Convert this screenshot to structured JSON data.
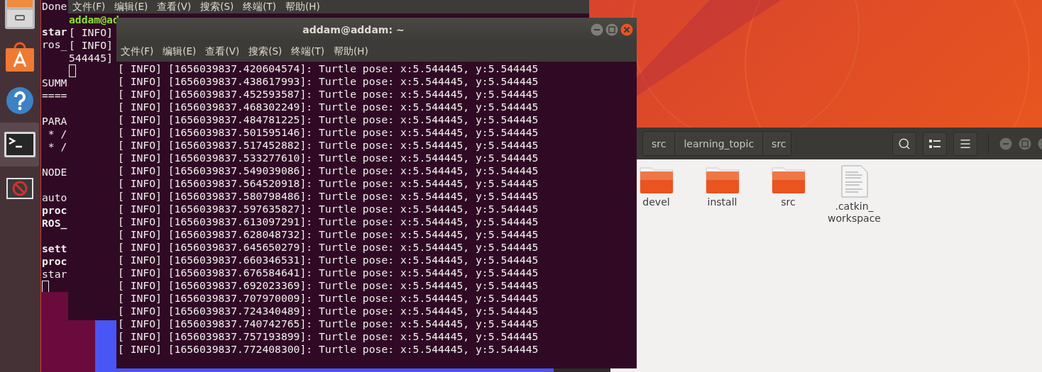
{
  "launcher": {
    "items": [
      {
        "kind": "files",
        "selected": false
      },
      {
        "kind": "store",
        "selected": false
      },
      {
        "kind": "help",
        "selected": false
      },
      {
        "kind": "terminal",
        "selected": true
      },
      {
        "kind": "blocked",
        "selected": false
      }
    ]
  },
  "back_terminal": {
    "cursor": true,
    "lines": [
      {
        "kind": "text",
        "text": "Done"
      },
      {
        "kind": "blank"
      },
      {
        "kind": "bold",
        "text": "star"
      },
      {
        "kind": "text",
        "text": "ros_"
      },
      {
        "kind": "blank"
      },
      {
        "kind": "blank"
      },
      {
        "kind": "text",
        "text": "SUMM"
      },
      {
        "kind": "text",
        "text": "===="
      },
      {
        "kind": "blank"
      },
      {
        "kind": "text",
        "text": "PARA"
      },
      {
        "kind": "text",
        "text": " * /"
      },
      {
        "kind": "text",
        "text": " * /"
      },
      {
        "kind": "blank"
      },
      {
        "kind": "text",
        "text": "NODE"
      },
      {
        "kind": "blank"
      },
      {
        "kind": "text",
        "text": "auto"
      },
      {
        "kind": "bold",
        "text": "proc"
      },
      {
        "kind": "bold",
        "text": "ROS_"
      },
      {
        "kind": "blank"
      },
      {
        "kind": "bold",
        "text": "sett"
      },
      {
        "kind": "bold",
        "text": "proc"
      },
      {
        "kind": "text",
        "text": "star"
      }
    ]
  },
  "middle_terminal": {
    "cursor": true,
    "menu": [
      "文件(F)",
      "编辑(E)",
      "查看(V)",
      "搜索(S)",
      "终端(T)",
      "帮助(H)"
    ],
    "lines": [
      {
        "kind": "prompt",
        "text": "addam@ad"
      },
      {
        "kind": "text",
        "text": "[ INFO]"
      },
      {
        "kind": "text",
        "text": "[ INFO]"
      },
      {
        "kind": "text",
        "text": "544445]"
      }
    ]
  },
  "front_terminal": {
    "title": "addam@addam: ~",
    "menu": [
      "文件(F)",
      "编辑(E)",
      "查看(V)",
      "搜索(S)",
      "终端(T)",
      "帮助(H)"
    ],
    "lines": [
      {
        "kind": "text",
        "text": "[ INFO] [1656039837.420604574]: Turtle pose: x:5.544445, y:5.544445"
      },
      {
        "kind": "text",
        "text": "[ INFO] [1656039837.438617993]: Turtle pose: x:5.544445, y:5.544445"
      },
      {
        "kind": "text",
        "text": "[ INFO] [1656039837.452593587]: Turtle pose: x:5.544445, y:5.544445"
      },
      {
        "kind": "text",
        "text": "[ INFO] [1656039837.468302249]: Turtle pose: x:5.544445, y:5.544445"
      },
      {
        "kind": "text",
        "text": "[ INFO] [1656039837.484781225]: Turtle pose: x:5.544445, y:5.544445"
      },
      {
        "kind": "text",
        "text": "[ INFO] [1656039837.501595146]: Turtle pose: x:5.544445, y:5.544445"
      },
      {
        "kind": "text",
        "text": "[ INFO] [1656039837.517452882]: Turtle pose: x:5.544445, y:5.544445"
      },
      {
        "kind": "text",
        "text": "[ INFO] [1656039837.533277610]: Turtle pose: x:5.544445, y:5.544445"
      },
      {
        "kind": "text",
        "text": "[ INFO] [1656039837.549039086]: Turtle pose: x:5.544445, y:5.544445"
      },
      {
        "kind": "text",
        "text": "[ INFO] [1656039837.564520918]: Turtle pose: x:5.544445, y:5.544445"
      },
      {
        "kind": "text",
        "text": "[ INFO] [1656039837.580798486]: Turtle pose: x:5.544445, y:5.544445"
      },
      {
        "kind": "text",
        "text": "[ INFO] [1656039837.597635827]: Turtle pose: x:5.544445, y:5.544445"
      },
      {
        "kind": "text",
        "text": "[ INFO] [1656039837.613097291]: Turtle pose: x:5.544445, y:5.544445"
      },
      {
        "kind": "text",
        "text": "[ INFO] [1656039837.628048732]: Turtle pose: x:5.544445, y:5.544445"
      },
      {
        "kind": "text",
        "text": "[ INFO] [1656039837.645650279]: Turtle pose: x:5.544445, y:5.544445"
      },
      {
        "kind": "text",
        "text": "[ INFO] [1656039837.660346531]: Turtle pose: x:5.544445, y:5.544445"
      },
      {
        "kind": "text",
        "text": "[ INFO] [1656039837.676584641]: Turtle pose: x:5.544445, y:5.544445"
      },
      {
        "kind": "text",
        "text": "[ INFO] [1656039837.692023369]: Turtle pose: x:5.544445, y:5.544445"
      },
      {
        "kind": "text",
        "text": "[ INFO] [1656039837.707970009]: Turtle pose: x:5.544445, y:5.544445"
      },
      {
        "kind": "text",
        "text": "[ INFO] [1656039837.724340489]: Turtle pose: x:5.544445, y:5.544445"
      },
      {
        "kind": "text",
        "text": "[ INFO] [1656039837.740742765]: Turtle pose: x:5.544445, y:5.544445"
      },
      {
        "kind": "text",
        "text": "[ INFO] [1656039837.757193899]: Turtle pose: x:5.544445, y:5.544445"
      },
      {
        "kind": "text",
        "text": "[ INFO] [1656039837.772408300]: Turtle pose: x:5.544445, y:5.544445"
      }
    ]
  },
  "file_manager": {
    "path": [
      {
        "label": "src"
      },
      {
        "label": "learning_topic"
      },
      {
        "label": "src"
      }
    ],
    "items": [
      {
        "kind": "folder",
        "lines": [
          "devel"
        ]
      },
      {
        "kind": "folder",
        "lines": [
          "install"
        ]
      },
      {
        "kind": "folder",
        "lines": [
          "src"
        ]
      },
      {
        "kind": "file",
        "lines": [
          ".catkin_",
          "workspace"
        ]
      }
    ]
  }
}
